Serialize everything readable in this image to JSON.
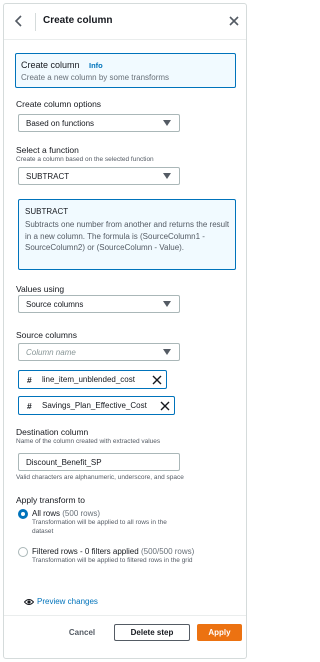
{
  "header": {
    "title": "Create column"
  },
  "info": {
    "title": "Create column",
    "link": "Info",
    "subtitle": "Create a new column by some transforms"
  },
  "options": {
    "label": "Create column options",
    "value": "Based on functions"
  },
  "function": {
    "label": "Select a function",
    "sublabel": "Create a column based on the selected function",
    "value": "SUBTRACT"
  },
  "description": {
    "title": "SUBTRACT",
    "text": "Subtracts one number from another and returns the result in a new column. The formula is (SourceColumn1 - SourceColumn2) or (SourceColumn - Value)."
  },
  "values_using": {
    "label": "Values using",
    "value": "Source columns"
  },
  "source_columns": {
    "label": "Source columns",
    "placeholder": "Column name",
    "chips": [
      {
        "hash": "#",
        "name": "line_item_unblended_cost"
      },
      {
        "hash": "#",
        "name": "Savings_Plan_Effective_Cost"
      }
    ]
  },
  "destination": {
    "label": "Destination column",
    "sublabel": "Name of the column created with extracted values",
    "value": "Discount_Benefit_SP",
    "hint": "Valid characters are alphanumeric, underscore, and space"
  },
  "apply_transform": {
    "label": "Apply transform to",
    "options": [
      {
        "label": "All rows",
        "count": "(500 rows)",
        "description": "Transformation will be applied to all rows in the dataset",
        "selected": true
      },
      {
        "label": "Filtered rows - 0 filters applied",
        "count": "(500/500 rows)",
        "description": "Transformation will be applied to filtered rows in the grid",
        "selected": false
      }
    ]
  },
  "footer": {
    "preview": "Preview changes",
    "cancel": "Cancel",
    "delete": "Delete step",
    "apply": "Apply"
  },
  "colors": {
    "accent": "#0073bb",
    "primary_button": "#ec7211",
    "info_bg": "#f1faff"
  },
  "icons": {
    "back": "chevron-left-icon",
    "close": "close-icon",
    "caret": "caret-down-icon",
    "remove": "remove-x-icon",
    "preview": "eye-icon"
  }
}
